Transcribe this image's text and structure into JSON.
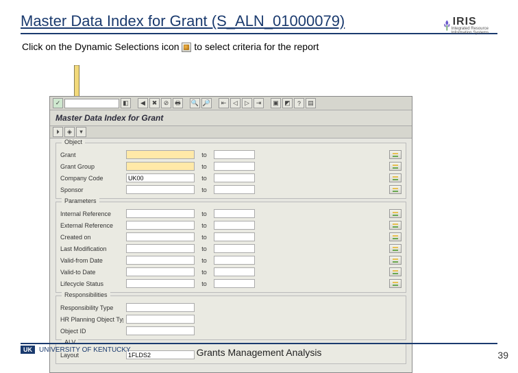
{
  "title": "Master Data Index for Grant (S_ALN_01000079)",
  "logo": {
    "name": "IRIS",
    "sub": "Integrated Resource Information Systems"
  },
  "instruction_before": "Click on the Dynamic Selections icon ",
  "instruction_after": " to select criteria for the report",
  "sap": {
    "screen_title": "Master Data Index for Grant",
    "groups": {
      "object": {
        "title": "Object",
        "rows": [
          {
            "label": "Grant",
            "value": "",
            "to": "to",
            "hi": true
          },
          {
            "label": "Grant Group",
            "value": "",
            "to": "to",
            "hi": true
          },
          {
            "label": "Company Code",
            "value": "UK00",
            "to": "to"
          },
          {
            "label": "Sponsor",
            "value": "",
            "to": "to"
          }
        ]
      },
      "parameters": {
        "title": "Parameters",
        "rows": [
          {
            "label": "Internal Reference",
            "value": "",
            "to": "to"
          },
          {
            "label": "External Reference",
            "value": "",
            "to": "to"
          },
          {
            "label": "Created on",
            "value": "",
            "to": "to"
          },
          {
            "label": "Last Modification",
            "value": "",
            "to": "to"
          },
          {
            "label": "Valid-from Date",
            "value": "",
            "to": "to"
          },
          {
            "label": "Valid-to Date",
            "value": "",
            "to": "to"
          },
          {
            "label": "Lifecycle Status",
            "value": "",
            "to": "to"
          }
        ]
      },
      "responsibilities": {
        "title": "Responsibilities",
        "rows": [
          {
            "label": "Responsibility Type",
            "value": ""
          },
          {
            "label": "HR Planning Object Type",
            "value": ""
          },
          {
            "label": "Object ID",
            "value": ""
          }
        ]
      },
      "layout": {
        "title": "ALV",
        "rows": [
          {
            "label": "Layout",
            "value": "1FLDS2"
          }
        ]
      }
    }
  },
  "footer": {
    "org": "UNIVERSITY OF KENTUCKY",
    "badge": "UK",
    "center": "Grants Management Analysis",
    "page": "39"
  }
}
